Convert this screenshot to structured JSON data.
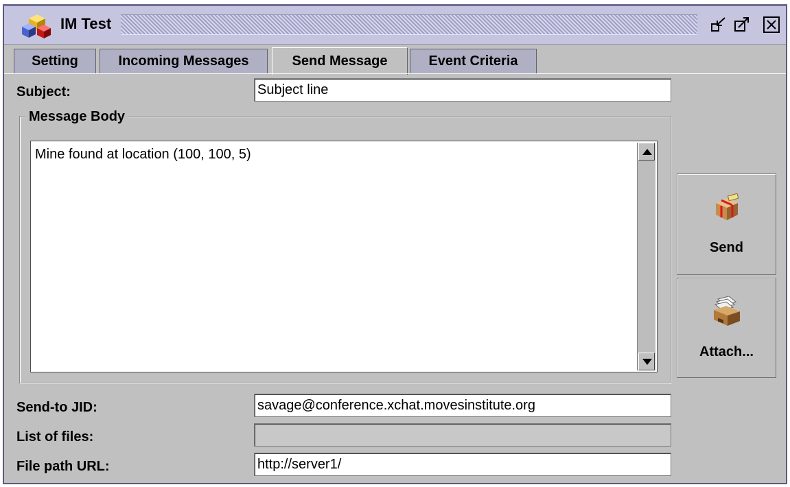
{
  "window": {
    "title": "IM Test",
    "icons": [
      "app-cubes-icon",
      "minimize-icon",
      "maximize-icon",
      "close-icon"
    ]
  },
  "tabs": [
    {
      "label": "Setting",
      "active": false
    },
    {
      "label": "Incoming Messages",
      "active": false
    },
    {
      "label": "Send Message",
      "active": true
    },
    {
      "label": "Event Criteria",
      "active": false
    }
  ],
  "form": {
    "subject_label": "Subject:",
    "subject_value": "Subject line",
    "message_group_title": "Message Body",
    "message_body": "Mine found at location (100, 100, 5)",
    "send_to_label": "Send-to JID:",
    "send_to_value": "savage@conference.xchat.movesinstitute.org",
    "files_label": "List of files:",
    "files_value": "",
    "file_url_label": "File path URL:",
    "file_url_value": "http://server1/"
  },
  "actions": {
    "send_label": "Send",
    "send_icon": "gift-package-icon",
    "attach_label": "Attach...",
    "attach_icon": "file-box-icon"
  },
  "colors": {
    "titlebar": "#c5c5e0",
    "panel": "#c0c0c0",
    "tab_inactive": "#b0b0c4"
  }
}
